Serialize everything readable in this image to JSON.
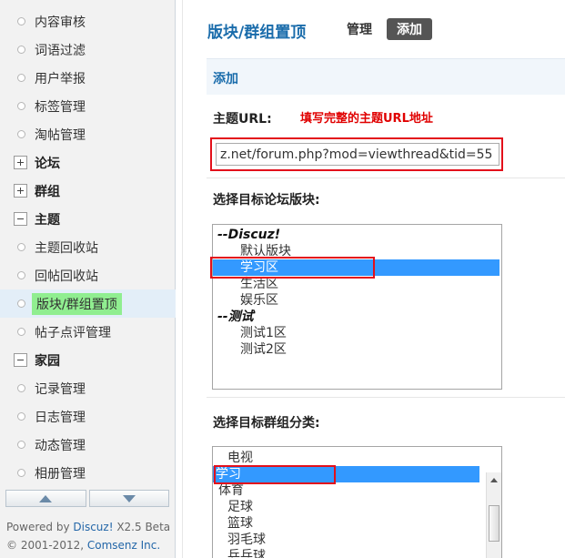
{
  "sidebar": {
    "items": [
      {
        "label": "内容审核",
        "type": "link"
      },
      {
        "label": "词语过滤",
        "type": "link"
      },
      {
        "label": "用户举报",
        "type": "link"
      },
      {
        "label": "标签管理",
        "type": "link"
      },
      {
        "label": "淘帖管理",
        "type": "link"
      },
      {
        "label": "论坛",
        "type": "group",
        "state": "collapsed"
      },
      {
        "label": "群组",
        "type": "group",
        "state": "collapsed"
      },
      {
        "label": "主题",
        "type": "group",
        "state": "expanded"
      },
      {
        "label": "主题回收站",
        "type": "link"
      },
      {
        "label": "回帖回收站",
        "type": "link"
      },
      {
        "label": "版块/群组置顶",
        "type": "link",
        "active": true
      },
      {
        "label": "帖子点评管理",
        "type": "link"
      },
      {
        "label": "家园",
        "type": "group",
        "state": "expanded"
      },
      {
        "label": "记录管理",
        "type": "link"
      },
      {
        "label": "日志管理",
        "type": "link"
      },
      {
        "label": "动态管理",
        "type": "link"
      },
      {
        "label": "相册管理",
        "type": "link"
      }
    ],
    "scroll_up_icon": "arrow-up-icon",
    "scroll_down_icon": "arrow-down-icon"
  },
  "footer": {
    "powered_prefix": "Powered by ",
    "powered_link": "Discuz!",
    "powered_version": " X2.5 Beta",
    "copyright_prefix": "© 2001-2012, ",
    "copyright_link": "Comsenz Inc."
  },
  "header": {
    "title": "版块/群组置顶",
    "tab_manage": "管理",
    "tab_add": "添加"
  },
  "section_title": "添加",
  "form": {
    "url_label": "主题URL:",
    "url_hint": "填写完整的主题URL地址",
    "url_value": "z.net/forum.php?mod=viewthread&tid=55",
    "forum_label": "选择目标论坛版块:",
    "forum_options": [
      {
        "text": "--Discuz!",
        "kind": "group"
      },
      {
        "text": "默认版块",
        "kind": "option"
      },
      {
        "text": "学习区",
        "kind": "option",
        "selected": true
      },
      {
        "text": "生活区",
        "kind": "option"
      },
      {
        "text": "娱乐区",
        "kind": "option"
      },
      {
        "text": "--测试",
        "kind": "group"
      },
      {
        "text": "测试1区",
        "kind": "option"
      },
      {
        "text": "测试2区",
        "kind": "option"
      }
    ],
    "group_label": "选择目标群组分类:",
    "group_options": [
      {
        "text": "电视",
        "level": 1
      },
      {
        "text": "学习",
        "level": 0,
        "selected": true
      },
      {
        "text": "体育",
        "level": 0
      },
      {
        "text": "足球",
        "level": 1
      },
      {
        "text": "篮球",
        "level": 1
      },
      {
        "text": "羽毛球",
        "level": 1
      },
      {
        "text": "乒乓球",
        "level": 1
      }
    ]
  },
  "colors": {
    "accent_blue": "#1a6cab",
    "highlight_red": "#e3101b",
    "selection_blue": "#3399ff",
    "active_green": "#90ee90"
  }
}
